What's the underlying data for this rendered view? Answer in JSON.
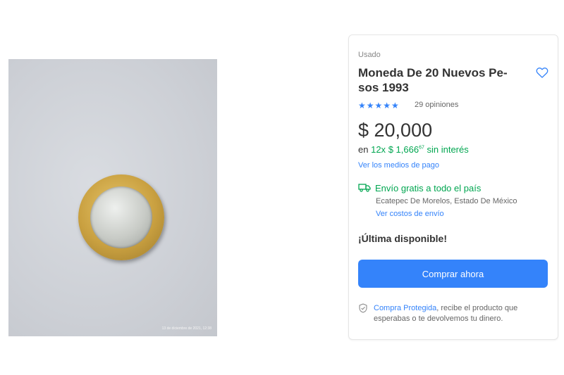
{
  "photo": {
    "timestamp": "13 de diciembre de 2021, 12:38"
  },
  "product": {
    "condition": "Usado",
    "title": "Moneda De 20 Nuevos Pe-sos 1993",
    "stars": "★★★★★",
    "reviews": "29 opiniones",
    "rating": 5,
    "price": "$ 20,000",
    "installments": {
      "prefix": "en",
      "count": "12x",
      "amount": "$ 1,666",
      "cents": "67",
      "suffix": "sin interés"
    },
    "payment_link": "Ver los medios de pago"
  },
  "shipping": {
    "label": "Envío gratis a todo el país",
    "location": "Ecatepec De Morelos, Estado De México",
    "cost_link": "Ver costos de envío"
  },
  "stock": {
    "label": "¡Última disponible!"
  },
  "actions": {
    "buy_label": "Comprar ahora"
  },
  "protection": {
    "link": "Compra Protegida",
    "text": ", recibe el producto que esperabas o te devolvemos tu dinero."
  },
  "colors": {
    "accent": "#3483fa",
    "success": "#00a650"
  },
  "icons": {
    "favorite": "heart-icon",
    "shipping": "truck-icon",
    "protection": "shield-check-icon"
  }
}
